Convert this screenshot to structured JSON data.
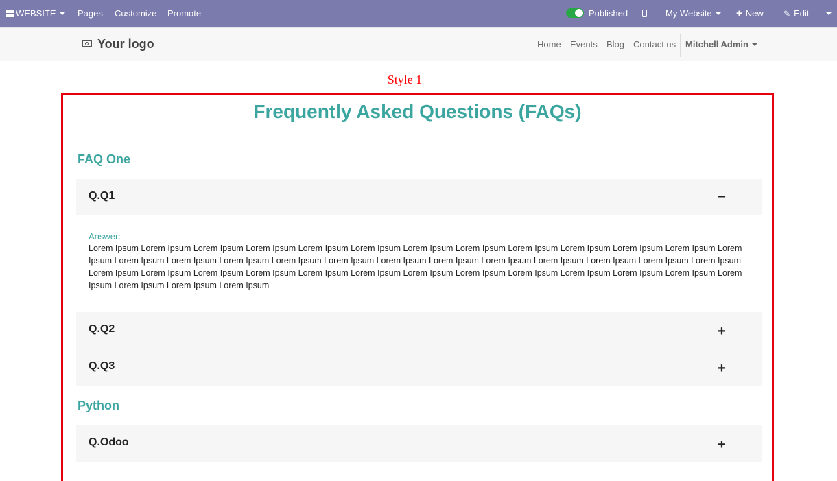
{
  "admin_bar": {
    "apps_label": "WEBSITE",
    "menu": [
      "Pages",
      "Customize",
      "Promote"
    ],
    "published_label": "Published",
    "my_website_label": "My Website",
    "new_label": "New",
    "edit_label": "Edit"
  },
  "site_header": {
    "logo_text": "Your logo",
    "nav": [
      "Home",
      "Events",
      "Blog",
      "Contact us"
    ],
    "user_name": "Mitchell Admin"
  },
  "content": {
    "style_label": "Style 1",
    "faq_title": "Frequently Asked Questions (FAQs)",
    "categories": [
      {
        "name": "FAQ One",
        "questions": [
          {
            "label": "Q.Q1",
            "expanded": true,
            "toggle": "−"
          },
          {
            "label": "Q.Q2",
            "expanded": false,
            "toggle": "+"
          },
          {
            "label": "Q.Q3",
            "expanded": false,
            "toggle": "+"
          }
        ]
      },
      {
        "name": "Python",
        "questions": [
          {
            "label": "Q.Odoo",
            "expanded": false,
            "toggle": "+"
          }
        ]
      }
    ],
    "answer_label": "Answer:",
    "answer_text": "Lorem Ipsum Lorem Ipsum Lorem Ipsum Lorem Ipsum Lorem Ipsum Lorem Ipsum Lorem Ipsum Lorem Ipsum Lorem Ipsum Lorem Ipsum Lorem Ipsum Lorem Ipsum Lorem Ipsum Lorem Ipsum Lorem Ipsum Lorem Ipsum Lorem Ipsum Lorem Ipsum Lorem Ipsum Lorem Ipsum Lorem Ipsum Lorem Ipsum Lorem Ipsum Lorem Ipsum Lorem Ipsum Lorem Ipsum Lorem Ipsum Lorem Ipsum Lorem Ipsum Lorem Ipsum Lorem Ipsum Lorem Ipsum Lorem Ipsum Lorem Ipsum Lorem Ipsum Lorem Ipsum Lorem Ipsum Lorem Ipsum Lorem Ipsum Lorem Ipsum Lorem Ipsum"
  },
  "colors": {
    "admin_bar": "#7c7bad",
    "accent": "#3ba5a0",
    "frame_border": "#e6000f",
    "style_label": "#ff0000",
    "question_bg": "#f6f6f6"
  },
  "icons": {
    "apps": "grid-icon",
    "published": "toggle-icon",
    "mobile_preview": "mobile-phone-icon",
    "new": "plus-icon",
    "edit": "pencil-icon",
    "logo": "camera-icon"
  }
}
